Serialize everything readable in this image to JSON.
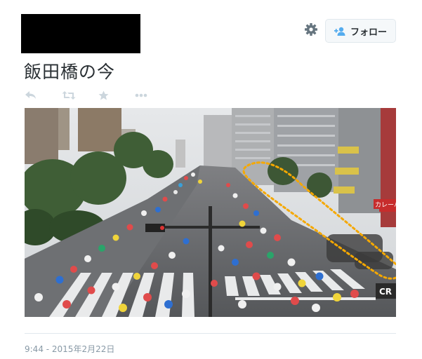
{
  "header": {
    "follow_label": "フォロー",
    "icons": {
      "settings": "gear-icon",
      "follow": "add-user-icon"
    }
  },
  "tweet": {
    "text": "飯田橋の今",
    "timestamp": "9:44 - 2015年2月22日"
  },
  "actions": [
    "reply-icon",
    "retweet-icon",
    "favorite-icon",
    "more-icon"
  ],
  "photo": {
    "sign_text": "カレーハウス",
    "corner_text": "CR"
  },
  "colors": {
    "accent": "#55acee",
    "muted_icon": "#ccd6dd",
    "highlight_dotted": "#f5a800"
  }
}
